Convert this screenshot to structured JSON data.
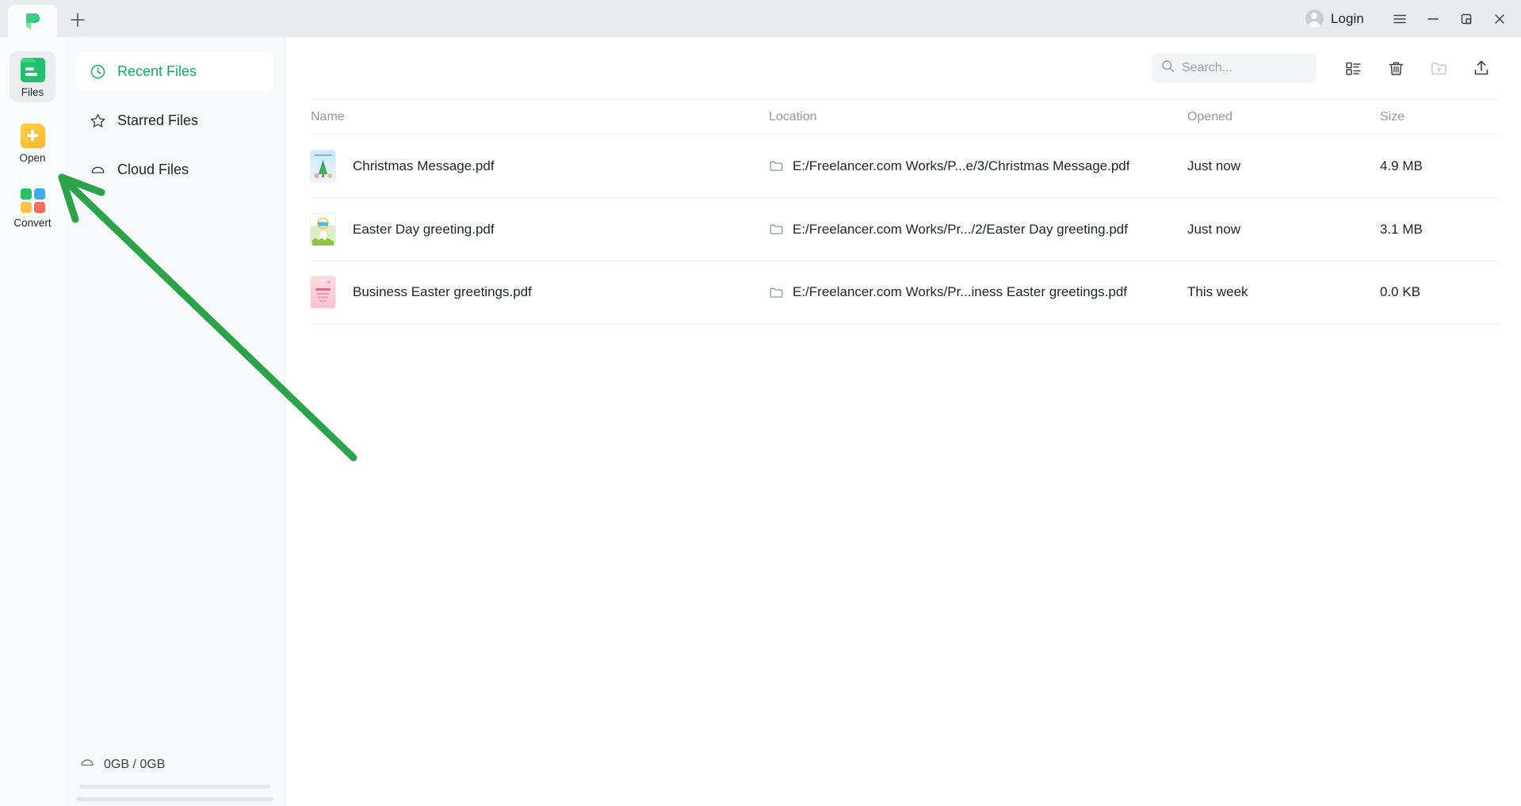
{
  "titlebar": {
    "tab_logo": "pdfgear-logo-icon",
    "new_tab_label": "+",
    "login_label": "Login",
    "menu_icon": "hamburger-menu-icon",
    "minimize_icon": "minimize-icon",
    "maximize_icon": "maximize-restore-icon",
    "close_icon": "close-icon"
  },
  "rail": {
    "items": [
      {
        "label": "Files",
        "icon": "files-icon",
        "active": true
      },
      {
        "label": "Open",
        "icon": "open-file-plus-icon",
        "active": false
      },
      {
        "label": "Convert",
        "icon": "convert-grid-icon",
        "active": false
      }
    ]
  },
  "nav": {
    "items": [
      {
        "label": "Recent Files",
        "icon": "clock-icon",
        "active": true
      },
      {
        "label": "Starred Files",
        "icon": "star-icon",
        "active": false
      },
      {
        "label": "Cloud Files",
        "icon": "cloud-icon",
        "active": false
      }
    ],
    "storage": {
      "icon": "cloud-icon",
      "text": "0GB / 0GB",
      "used_percent": 0
    }
  },
  "toolbar": {
    "search_placeholder": "Search...",
    "search_value": "",
    "search_icon": "search-icon",
    "view_toggle_icon": "list-view-icon",
    "delete_icon": "trash-icon",
    "new_folder_icon": "new-folder-icon",
    "upload_icon": "upload-icon"
  },
  "table": {
    "columns": [
      "Name",
      "Location",
      "Opened",
      "Size"
    ],
    "rows": [
      {
        "name": "Christmas Message.pdf",
        "location": "E:/Freelancer.com Works/P...e/3/Christmas Message.pdf",
        "opened": "Just now",
        "size": "4.9 MB",
        "thumb_colors": [
          "#bfe2f5",
          "#ffffff"
        ],
        "thumb_accent": "#2f9e52"
      },
      {
        "name": "Easter Day greeting.pdf",
        "location": "E:/Freelancer.com Works/Pr.../2/Easter Day greeting.pdf",
        "opened": "Just now",
        "size": "3.1 MB",
        "thumb_colors": [
          "#e8f4d8",
          "#ffffff"
        ],
        "thumb_accent": "#8cc63f"
      },
      {
        "name": "Business Easter greetings.pdf",
        "location": "E:/Freelancer.com Works/Pr...iness Easter greetings.pdf",
        "opened": "This week",
        "size": "0.0 KB",
        "thumb_colors": [
          "#f9ccd6",
          "#fbdde4"
        ],
        "thumb_accent": "#e0607f"
      }
    ]
  },
  "annotation": {
    "arrow_color": "#2aa34a",
    "arrow_target": "open-button"
  },
  "colors": {
    "brand_green": "#16a866",
    "titlebar_bg": "#e9ecef",
    "nav_bg": "#f8f9fa",
    "content_bg": "#ffffff"
  }
}
